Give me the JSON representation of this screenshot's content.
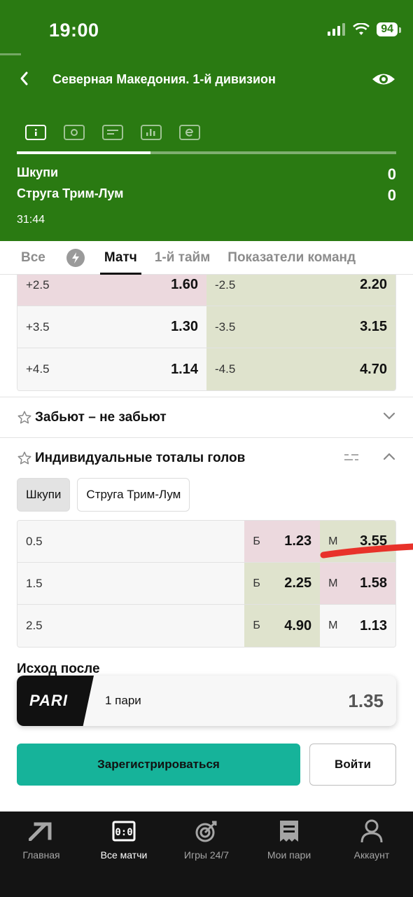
{
  "status": {
    "time": "19:00",
    "battery": "94"
  },
  "header": {
    "league": "Северная Македония. 1-й дивизион",
    "teams": [
      {
        "name": "Шкупи",
        "score": "0"
      },
      {
        "name": "Струга Трим-Лум",
        "score": "0"
      }
    ],
    "match_time": "31:44"
  },
  "tabs": [
    "Все",
    "Матч",
    "1-й тайм",
    "Показатели команд"
  ],
  "handicap": [
    {
      "left_label": "+2.5",
      "left_odd": "1.60",
      "right_label": "-2.5",
      "right_odd": "2.20"
    },
    {
      "left_label": "+3.5",
      "left_odd": "1.30",
      "right_label": "-3.5",
      "right_odd": "3.15"
    },
    {
      "left_label": "+4.5",
      "left_odd": "1.14",
      "right_label": "-4.5",
      "right_odd": "4.70"
    }
  ],
  "sections": {
    "both_score": "Забьют – не забьют",
    "individual_totals": "Индивидуальные тоталы голов",
    "next": "Исход после"
  },
  "team_tabs": [
    "Шкупи",
    "Струга Трим-Лум"
  ],
  "totals": [
    {
      "line": "0.5",
      "over_label": "Б",
      "over": "1.23",
      "under_label": "М",
      "under": "3.55"
    },
    {
      "line": "1.5",
      "over_label": "Б",
      "over": "2.25",
      "under_label": "М",
      "under": "1.58"
    },
    {
      "line": "2.5",
      "over_label": "Б",
      "over": "4.90",
      "under_label": "М",
      "under": "1.13"
    }
  ],
  "betslip": {
    "logo": "PARI",
    "count": "1 пари",
    "odds": "1.35"
  },
  "actions": {
    "register": "Зарегистрироваться",
    "login": "Войти"
  },
  "nav": [
    {
      "label": "Главная"
    },
    {
      "label": "Все матчи"
    },
    {
      "label": "Игры 24/7"
    },
    {
      "label": "Мои пари"
    },
    {
      "label": "Аккаунт"
    }
  ],
  "colors": {
    "header_green": "#2a7a12",
    "accent_teal": "#16b39a",
    "mark_red": "#e8322a"
  }
}
